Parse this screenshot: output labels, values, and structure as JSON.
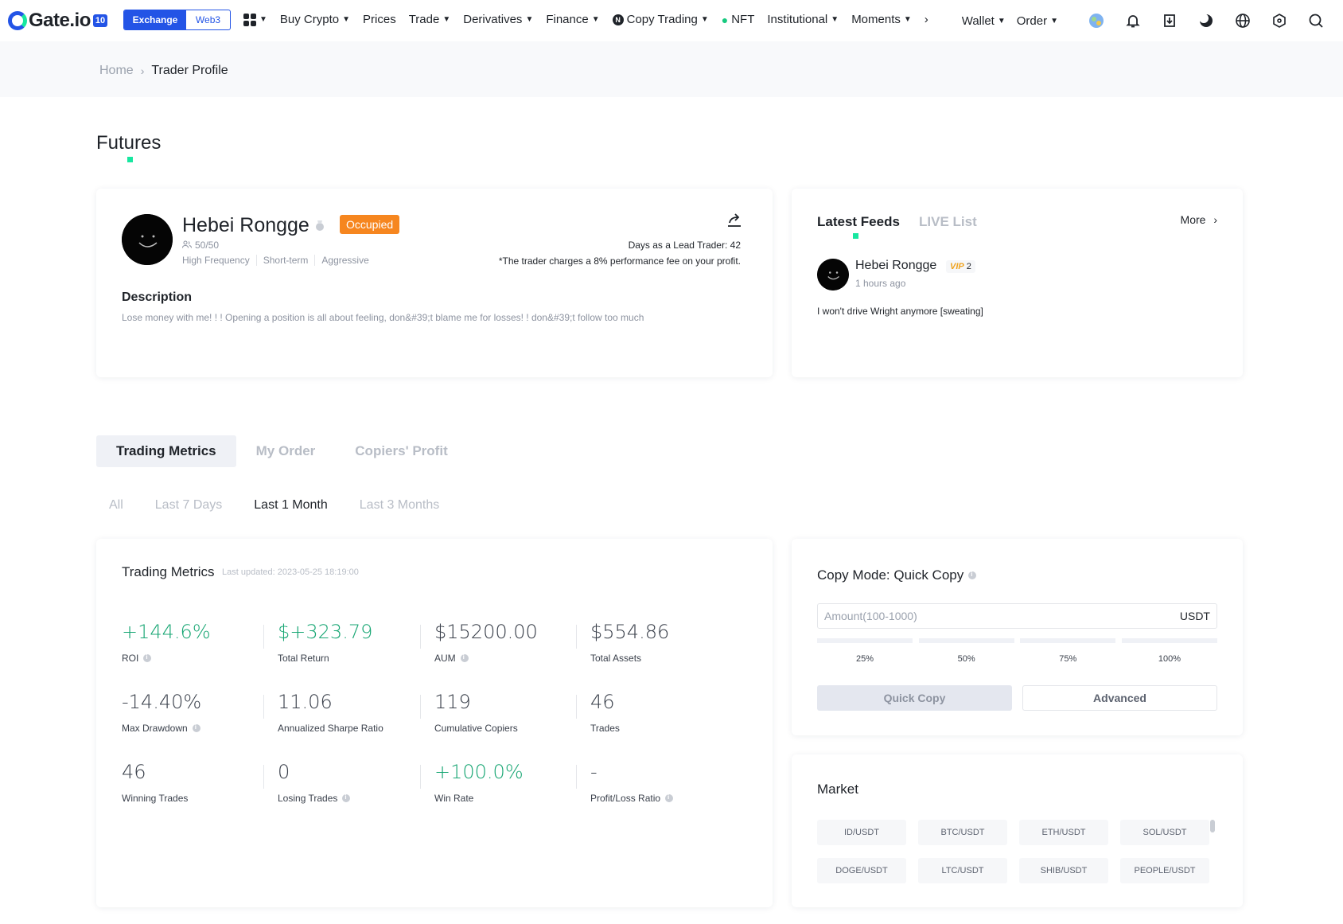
{
  "nav": {
    "logo_text": "Gate.io",
    "logo_badge": "10",
    "mode_exchange": "Exchange",
    "mode_web3": "Web3",
    "items": [
      "Buy Crypto",
      "Prices",
      "Trade",
      "Derivatives",
      "Finance",
      "Copy Trading",
      "NFT",
      "Institutional",
      "Moments"
    ],
    "wallet": "Wallet",
    "order": "Order",
    "copy_badge": "N"
  },
  "breadcrumb": {
    "home": "Home",
    "current": "Trader Profile"
  },
  "page_title": "Futures",
  "profile": {
    "name": "Hebei Rongge",
    "status": "Occupied",
    "copiers": "50/50",
    "tags": [
      "High Frequency",
      "Short-term",
      "Aggressive"
    ],
    "days_lead": "Days as a Lead Trader: 42",
    "fee_note": "*The trader charges a 8% performance fee on your profit.",
    "description_title": "Description",
    "description": "Lose money with me! ! ! Opening a position is all about feeling, don&#39;t blame me for losses! ! don&#39;t follow too much"
  },
  "feeds": {
    "tab_active": "Latest Feeds",
    "tab_other": "LIVE List",
    "more": "More",
    "post": {
      "name": "Hebei Rongge",
      "vip_level": "2",
      "vip_label": "VIP",
      "time": "1 hours ago",
      "text": "I won't drive Wright anymore [sweating]"
    }
  },
  "tabs": {
    "main": [
      "Trading Metrics",
      "My Order",
      "Copiers' Profit"
    ],
    "period": [
      "All",
      "Last 7 Days",
      "Last 1 Month",
      "Last 3 Months"
    ]
  },
  "metrics": {
    "title": "Trading Metrics",
    "updated": "Last updated: 2023-05-25 18:19:00",
    "items": [
      {
        "value": "+144.6%",
        "label": "ROI"
      },
      {
        "value": "$+323.79",
        "label": "Total Return"
      },
      {
        "value": "$15200.00",
        "label": "AUM"
      },
      {
        "value": "$554.86",
        "label": "Total Assets"
      },
      {
        "value": "-14.40%",
        "label": "Max Drawdown"
      },
      {
        "value": "11.06",
        "label": "Annualized Sharpe Ratio"
      },
      {
        "value": "119",
        "label": "Cumulative Copiers"
      },
      {
        "value": "46",
        "label": "Trades"
      },
      {
        "value": "46",
        "label": "Winning Trades"
      },
      {
        "value": "0",
        "label": "Losing Trades"
      },
      {
        "value": "+100.0%",
        "label": "Win Rate"
      },
      {
        "value": "-",
        "label": "Profit/Loss Ratio"
      }
    ],
    "positive_color": "#17a673"
  },
  "copy": {
    "title": "Copy Mode: Quick Copy",
    "amount_placeholder": "Amount(100-1000)",
    "amount_unit": "USDT",
    "percents": [
      "25%",
      "50%",
      "75%",
      "100%"
    ],
    "quick_copy": "Quick Copy",
    "advanced": "Advanced"
  },
  "market": {
    "title": "Market",
    "pairs": [
      "ID/USDT",
      "BTC/USDT",
      "ETH/USDT",
      "SOL/USDT",
      "DOGE/USDT",
      "LTC/USDT",
      "SHIB/USDT",
      "PEOPLE/USDT"
    ]
  },
  "colors": {
    "brand_blue": "#2354e6",
    "accent_green": "#17e7a0",
    "occupied_orange": "#f6861f"
  }
}
